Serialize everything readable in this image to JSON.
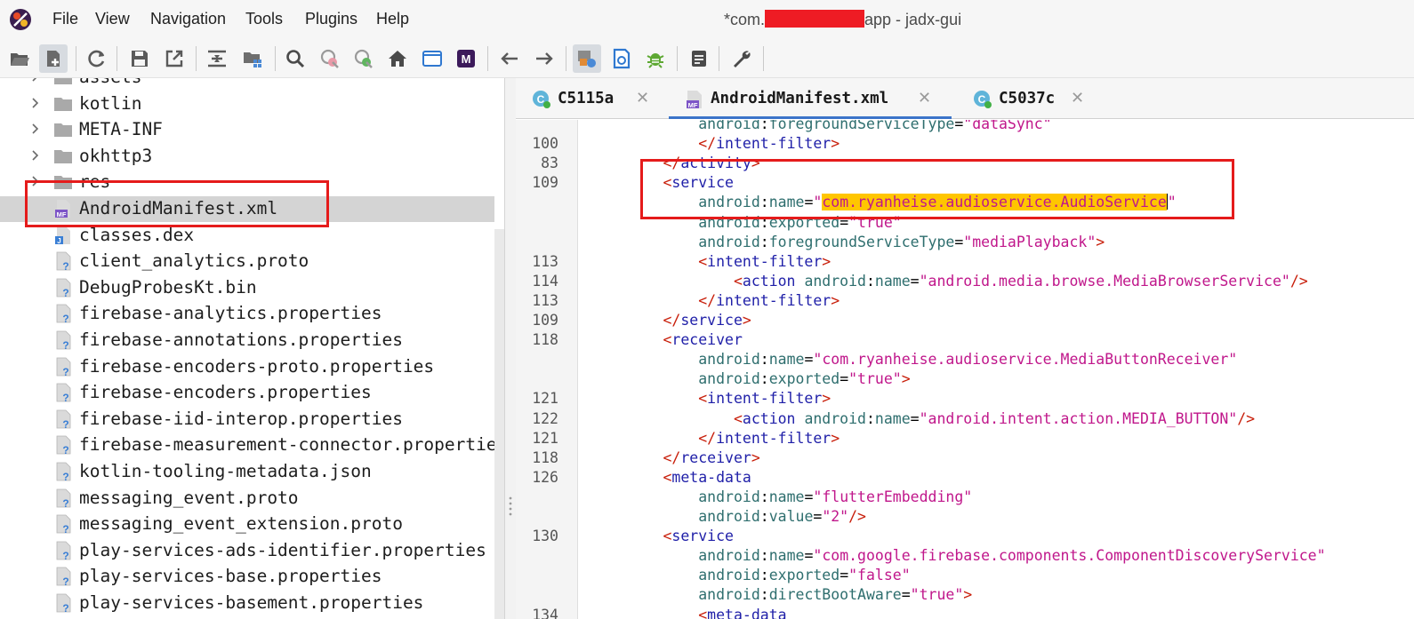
{
  "menubar": {
    "items": [
      "File",
      "View",
      "Navigation",
      "Tools",
      "Plugins",
      "Help"
    ],
    "title_prefix": "*com.",
    "title_suffix": "app - jadx-gui"
  },
  "toolbar": {
    "buttons": [
      "open-file",
      "add-files",
      "reload",
      "save-all",
      "export",
      "sync-with-editor",
      "flatten-packages",
      "search-text",
      "search-class",
      "search-usage",
      "home",
      "show-log",
      "smali",
      "back",
      "forward",
      "decompile-all",
      "quark",
      "debug",
      "log-viewer",
      "preferences"
    ]
  },
  "tree": {
    "items": [
      {
        "label": "assets",
        "type": "folder",
        "expandable": true
      },
      {
        "label": "kotlin",
        "type": "folder",
        "expandable": true
      },
      {
        "label": "META-INF",
        "type": "folder",
        "expandable": true
      },
      {
        "label": "okhttp3",
        "type": "folder",
        "expandable": true
      },
      {
        "label": "res",
        "type": "folder",
        "expandable": true
      },
      {
        "label": "AndroidManifest.xml",
        "type": "manifest",
        "selected": true
      },
      {
        "label": "classes.dex",
        "type": "dex"
      },
      {
        "label": "client_analytics.proto",
        "type": "file"
      },
      {
        "label": "DebugProbesKt.bin",
        "type": "file"
      },
      {
        "label": "firebase-analytics.properties",
        "type": "file"
      },
      {
        "label": "firebase-annotations.properties",
        "type": "file"
      },
      {
        "label": "firebase-encoders-proto.properties",
        "type": "file"
      },
      {
        "label": "firebase-encoders.properties",
        "type": "file"
      },
      {
        "label": "firebase-iid-interop.properties",
        "type": "file"
      },
      {
        "label": "firebase-measurement-connector.properties",
        "type": "file"
      },
      {
        "label": "kotlin-tooling-metadata.json",
        "type": "file"
      },
      {
        "label": "messaging_event.proto",
        "type": "file"
      },
      {
        "label": "messaging_event_extension.proto",
        "type": "file"
      },
      {
        "label": "play-services-ads-identifier.properties",
        "type": "file"
      },
      {
        "label": "play-services-base.properties",
        "type": "file"
      },
      {
        "label": "play-services-basement.properties",
        "type": "file"
      }
    ]
  },
  "tabs": [
    {
      "label": "C5115a",
      "icon": "class",
      "active": false
    },
    {
      "label": "AndroidManifest.xml",
      "icon": "manifest",
      "active": true
    },
    {
      "label": "C5037c",
      "icon": "class",
      "active": false
    }
  ],
  "editor": {
    "lines": [
      {
        "num": "",
        "tokens": [
          [
            "sp",
            "            "
          ],
          [
            "attr",
            "android"
          ],
          [
            "sp",
            ":"
          ],
          [
            "attr",
            "foregroundServiceType"
          ],
          [
            "sp",
            "="
          ],
          [
            "val",
            "\"dataSync\""
          ]
        ]
      },
      {
        "num": "100",
        "tokens": [
          [
            "sp",
            "            "
          ],
          [
            "tag",
            "</"
          ],
          [
            "el",
            "intent-filter"
          ],
          [
            "tag",
            ">"
          ]
        ]
      },
      {
        "num": "83",
        "tokens": [
          [
            "sp",
            "        "
          ],
          [
            "tag",
            "</"
          ],
          [
            "el",
            "activity"
          ],
          [
            "tag",
            ">"
          ]
        ]
      },
      {
        "num": "109",
        "tokens": [
          [
            "sp",
            "        "
          ],
          [
            "tag",
            "<"
          ],
          [
            "el",
            "service"
          ]
        ]
      },
      {
        "num": "",
        "tokens": [
          [
            "sp",
            "            "
          ],
          [
            "attr",
            "android"
          ],
          [
            "sp",
            ":"
          ],
          [
            "attr",
            "name"
          ],
          [
            "sp",
            "="
          ],
          [
            "val",
            "\""
          ],
          [
            "hl",
            "com.ryanheise.audioservice.AudioService"
          ],
          [
            "caret",
            ""
          ],
          [
            "val",
            "\""
          ]
        ]
      },
      {
        "num": "",
        "tokens": [
          [
            "sp",
            "            "
          ],
          [
            "attr",
            "android"
          ],
          [
            "sp",
            ":"
          ],
          [
            "attr",
            "exported"
          ],
          [
            "sp",
            "="
          ],
          [
            "val",
            "\"true\""
          ]
        ]
      },
      {
        "num": "",
        "tokens": [
          [
            "sp",
            "            "
          ],
          [
            "attr",
            "android"
          ],
          [
            "sp",
            ":"
          ],
          [
            "attr",
            "foregroundServiceType"
          ],
          [
            "sp",
            "="
          ],
          [
            "val",
            "\"mediaPlayback\""
          ],
          [
            "tag",
            ">"
          ]
        ]
      },
      {
        "num": "113",
        "tokens": [
          [
            "sp",
            "            "
          ],
          [
            "tag",
            "<"
          ],
          [
            "el",
            "intent-filter"
          ],
          [
            "tag",
            ">"
          ]
        ]
      },
      {
        "num": "114",
        "tokens": [
          [
            "sp",
            "                "
          ],
          [
            "tag",
            "<"
          ],
          [
            "el",
            "action"
          ],
          [
            "sp",
            " "
          ],
          [
            "attr",
            "android"
          ],
          [
            "sp",
            ":"
          ],
          [
            "attr",
            "name"
          ],
          [
            "sp",
            "="
          ],
          [
            "val",
            "\"android.media.browse.MediaBrowserService\""
          ],
          [
            "tag",
            "/>"
          ]
        ]
      },
      {
        "num": "113",
        "tokens": [
          [
            "sp",
            "            "
          ],
          [
            "tag",
            "</"
          ],
          [
            "el",
            "intent-filter"
          ],
          [
            "tag",
            ">"
          ]
        ]
      },
      {
        "num": "109",
        "tokens": [
          [
            "sp",
            "        "
          ],
          [
            "tag",
            "</"
          ],
          [
            "el",
            "service"
          ],
          [
            "tag",
            ">"
          ]
        ]
      },
      {
        "num": "118",
        "tokens": [
          [
            "sp",
            "        "
          ],
          [
            "tag",
            "<"
          ],
          [
            "el",
            "receiver"
          ]
        ]
      },
      {
        "num": "",
        "tokens": [
          [
            "sp",
            "            "
          ],
          [
            "attr",
            "android"
          ],
          [
            "sp",
            ":"
          ],
          [
            "attr",
            "name"
          ],
          [
            "sp",
            "="
          ],
          [
            "val",
            "\"com.ryanheise.audioservice.MediaButtonReceiver\""
          ]
        ]
      },
      {
        "num": "",
        "tokens": [
          [
            "sp",
            "            "
          ],
          [
            "attr",
            "android"
          ],
          [
            "sp",
            ":"
          ],
          [
            "attr",
            "exported"
          ],
          [
            "sp",
            "="
          ],
          [
            "val",
            "\"true\""
          ],
          [
            "tag",
            ">"
          ]
        ]
      },
      {
        "num": "121",
        "tokens": [
          [
            "sp",
            "            "
          ],
          [
            "tag",
            "<"
          ],
          [
            "el",
            "intent-filter"
          ],
          [
            "tag",
            ">"
          ]
        ]
      },
      {
        "num": "122",
        "tokens": [
          [
            "sp",
            "                "
          ],
          [
            "tag",
            "<"
          ],
          [
            "el",
            "action"
          ],
          [
            "sp",
            " "
          ],
          [
            "attr",
            "android"
          ],
          [
            "sp",
            ":"
          ],
          [
            "attr",
            "name"
          ],
          [
            "sp",
            "="
          ],
          [
            "val",
            "\"android.intent.action.MEDIA_BUTTON\""
          ],
          [
            "tag",
            "/>"
          ]
        ]
      },
      {
        "num": "121",
        "tokens": [
          [
            "sp",
            "            "
          ],
          [
            "tag",
            "</"
          ],
          [
            "el",
            "intent-filter"
          ],
          [
            "tag",
            ">"
          ]
        ]
      },
      {
        "num": "118",
        "tokens": [
          [
            "sp",
            "        "
          ],
          [
            "tag",
            "</"
          ],
          [
            "el",
            "receiver"
          ],
          [
            "tag",
            ">"
          ]
        ]
      },
      {
        "num": "126",
        "tokens": [
          [
            "sp",
            "        "
          ],
          [
            "tag",
            "<"
          ],
          [
            "el",
            "meta-data"
          ]
        ]
      },
      {
        "num": "",
        "tokens": [
          [
            "sp",
            "            "
          ],
          [
            "attr",
            "android"
          ],
          [
            "sp",
            ":"
          ],
          [
            "attr",
            "name"
          ],
          [
            "sp",
            "="
          ],
          [
            "val",
            "\"flutterEmbedding\""
          ]
        ]
      },
      {
        "num": "",
        "tokens": [
          [
            "sp",
            "            "
          ],
          [
            "attr",
            "android"
          ],
          [
            "sp",
            ":"
          ],
          [
            "attr",
            "value"
          ],
          [
            "sp",
            "="
          ],
          [
            "val",
            "\"2\""
          ],
          [
            "tag",
            "/>"
          ]
        ]
      },
      {
        "num": "130",
        "tokens": [
          [
            "sp",
            "        "
          ],
          [
            "tag",
            "<"
          ],
          [
            "el",
            "service"
          ]
        ]
      },
      {
        "num": "",
        "tokens": [
          [
            "sp",
            "            "
          ],
          [
            "attr",
            "android"
          ],
          [
            "sp",
            ":"
          ],
          [
            "attr",
            "name"
          ],
          [
            "sp",
            "="
          ],
          [
            "val",
            "\"com.google.firebase.components.ComponentDiscoveryService\""
          ]
        ]
      },
      {
        "num": "",
        "tokens": [
          [
            "sp",
            "            "
          ],
          [
            "attr",
            "android"
          ],
          [
            "sp",
            ":"
          ],
          [
            "attr",
            "exported"
          ],
          [
            "sp",
            "="
          ],
          [
            "val",
            "\"false\""
          ]
        ]
      },
      {
        "num": "",
        "tokens": [
          [
            "sp",
            "            "
          ],
          [
            "attr",
            "android"
          ],
          [
            "sp",
            ":"
          ],
          [
            "attr",
            "directBootAware"
          ],
          [
            "sp",
            "="
          ],
          [
            "val",
            "\"true\""
          ],
          [
            "tag",
            ">"
          ]
        ]
      },
      {
        "num": "134",
        "tokens": [
          [
            "sp",
            "            "
          ],
          [
            "tag",
            "<"
          ],
          [
            "el",
            "meta-data"
          ]
        ]
      }
    ]
  },
  "colors": {
    "annotation_red": "#e51b1b",
    "highlight": "#ffc600",
    "tab_underline": "#3b74c9",
    "xml_tag": "#c81e0a",
    "xml_element": "#1f1fa8",
    "xml_attribute": "#2e6e6e",
    "xml_value": "#c0178b"
  }
}
